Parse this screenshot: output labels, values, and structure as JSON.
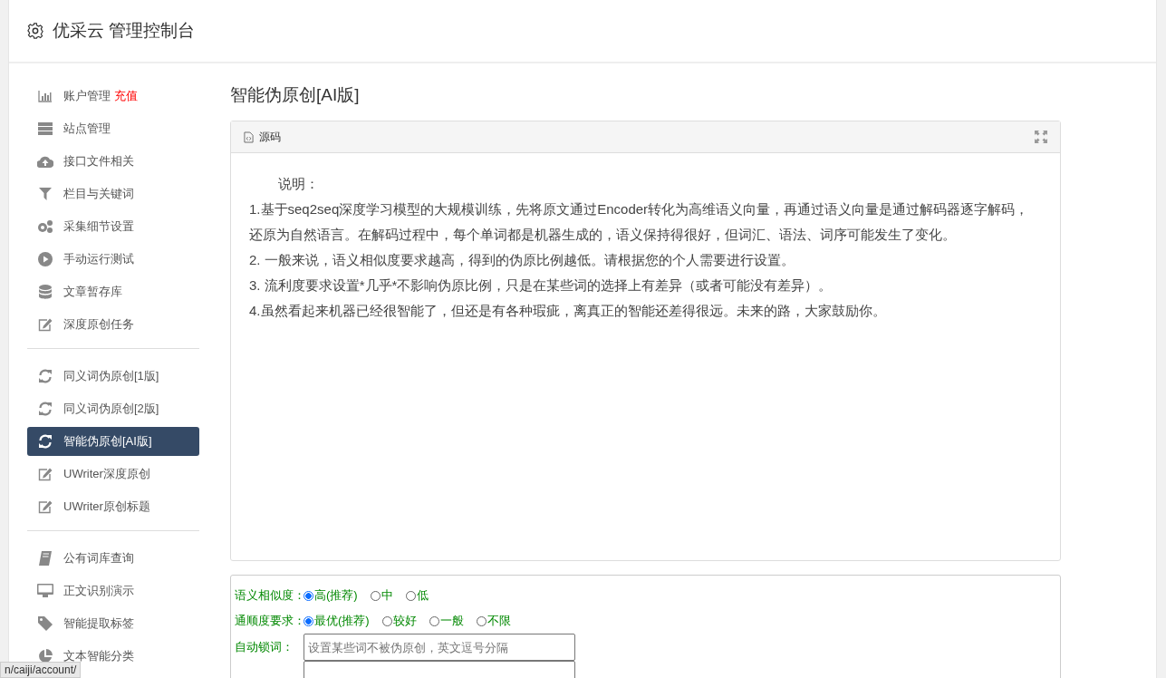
{
  "header": {
    "title": "优采云 管理控制台"
  },
  "sidebar": {
    "groups": [
      {
        "items": [
          {
            "label": "账户管理",
            "badge": "充值",
            "selected": false
          },
          {
            "label": "站点管理",
            "selected": false
          },
          {
            "label": "接口文件相关",
            "selected": false
          },
          {
            "label": "栏目与关键词",
            "selected": false
          },
          {
            "label": "采集细节设置",
            "selected": false
          },
          {
            "label": "手动运行测试",
            "selected": false
          },
          {
            "label": "文章暂存库",
            "selected": false
          },
          {
            "label": "深度原创任务",
            "selected": false
          }
        ]
      },
      {
        "items": [
          {
            "label": "同义词伪原创[1版]",
            "selected": false
          },
          {
            "label": "同义词伪原创[2版]",
            "selected": false
          },
          {
            "label": "智能伪原创[AI版]",
            "selected": true
          },
          {
            "label": "UWriter深度原创",
            "selected": false
          },
          {
            "label": "UWriter原创标题",
            "selected": false
          }
        ]
      },
      {
        "items": [
          {
            "label": "公有词库查询",
            "selected": false
          },
          {
            "label": "正文识别演示",
            "selected": false
          },
          {
            "label": "智能提取标签",
            "selected": false
          },
          {
            "label": "文本智能分类",
            "selected": false
          }
        ]
      }
    ]
  },
  "content": {
    "title": "智能伪原创[AI版]",
    "editor": {
      "toolbar_label": "源码",
      "paragraphs": [
        "说明：",
        "1.基于seq2seq深度学习模型的大规模训练，先将原文通过Encoder转化为高维语义向量，再通过语义向量是通过解码器逐字解码，还原为自然语言。在解码过程中，每个单词都是机器生成的，语义保持得很好，但词汇、语法、词序可能发生了变化。",
        "2. 一般来说，语义相似度要求越高，得到的伪原比例越低。请根据您的个人需要进行设置。",
        "3. 流利度要求设置*几乎*不影响伪原比例，只是在某些词的选择上有差异（或者可能没有差异）。",
        "4.虽然看起来机器已经很智能了，但还是有各种瑕疵，离真正的智能还差得很远。未来的路，大家鼓励你。"
      ]
    },
    "form": [
      {
        "kind": "radio",
        "label": "语义相似度：",
        "options": [
          {
            "label": "高(推荐)",
            "selected": true
          },
          {
            "label": "中",
            "selected": false
          },
          {
            "label": "低",
            "selected": false
          }
        ]
      },
      {
        "kind": "radio",
        "label": "通顺度要求：",
        "options": [
          {
            "label": "最优(推荐)",
            "selected": true
          },
          {
            "label": "较好",
            "selected": false
          },
          {
            "label": "一般",
            "selected": false
          },
          {
            "label": "不限",
            "selected": false
          }
        ]
      },
      {
        "kind": "text",
        "label": "自动锁词：",
        "placeholder": "设置某些词不被伪原创，英文逗号分隔"
      },
      {
        "kind": "text"
      }
    ]
  },
  "status_url": "n/caiji/account/"
}
